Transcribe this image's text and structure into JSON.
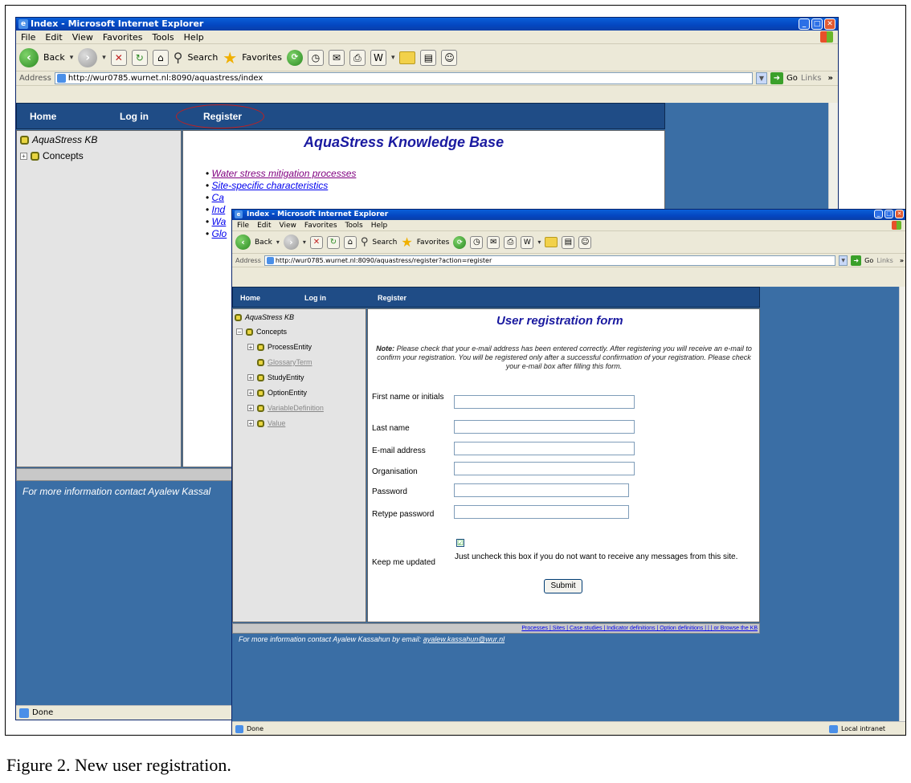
{
  "caption": "Figure 2. New user registration.",
  "back_window": {
    "title": "Index - Microsoft Internet Explorer",
    "menu": [
      "File",
      "Edit",
      "View",
      "Favorites",
      "Tools",
      "Help"
    ],
    "toolbar": {
      "back": "Back",
      "search": "Search",
      "favorites": "Favorites"
    },
    "address_label": "Address",
    "address_value": "http://wur0785.wurnet.nl:8090/aquastress/index",
    "go": "Go",
    "links": "Links",
    "links_arrow": "»",
    "nav": {
      "home": "Home",
      "login": "Log in",
      "register": "Register"
    },
    "tree": {
      "root": "AquaStress KB",
      "concepts": "Concepts"
    },
    "page_title": "AquaStress Knowledge Base",
    "links_list": [
      "Water stress mitigation processes",
      "Site-specific characteristics",
      "Ca",
      "Ind",
      "Wa",
      "Glo"
    ],
    "footer": "For more information contact Ayalew Kassal",
    "status": "Done"
  },
  "front_window": {
    "title": "Index - Microsoft Internet Explorer",
    "menu": [
      "File",
      "Edit",
      "View",
      "Favorites",
      "Tools",
      "Help"
    ],
    "toolbar": {
      "back": "Back",
      "search": "Search",
      "favorites": "Favorites"
    },
    "address_label": "Address",
    "address_value": "http://wur0785.wurnet.nl:8090/aquastress/register?action=register",
    "go": "Go",
    "links": "Links",
    "links_arrow": "»",
    "nav": {
      "home": "Home",
      "login": "Log in",
      "register": "Register"
    },
    "tree": {
      "root": "AquaStress KB",
      "concepts": "Concepts",
      "children": [
        "ProcessEntity",
        "GlossaryTerm",
        "StudyEntity",
        "OptionEntity",
        "VariableDefinition",
        "Value"
      ]
    },
    "form_title": "User registration form",
    "note_label": "Note:",
    "note_text": "Please check that your e-mail address has been entered correctly. After registering you will receive an e-mail to confirm your registration. You will be registered only after a successful confirmation of your registration. Please check your e-mail box after filling this form.",
    "fields": {
      "first_name": "First name or initials",
      "last_name": "Last name",
      "email": "E-mail address",
      "organisation": "Organisation",
      "password": "Password",
      "retype_password": "Retype password",
      "keep_updated": "Keep me updated",
      "keep_updated_hint": "Just uncheck this box if you do not want to receive any messages from this site.",
      "checkbox_mark": "☑"
    },
    "submit": "Submit",
    "bottom_links": "Processes | Sites | Case studies | Indicator definitions | Option definitions | | | or Browse the KB",
    "footer_text": "For more information contact Ayalew Kassahun by email:",
    "footer_email": "ayalew.kassahun@wur.nl",
    "status": "Done",
    "zone": "Local intranet"
  }
}
